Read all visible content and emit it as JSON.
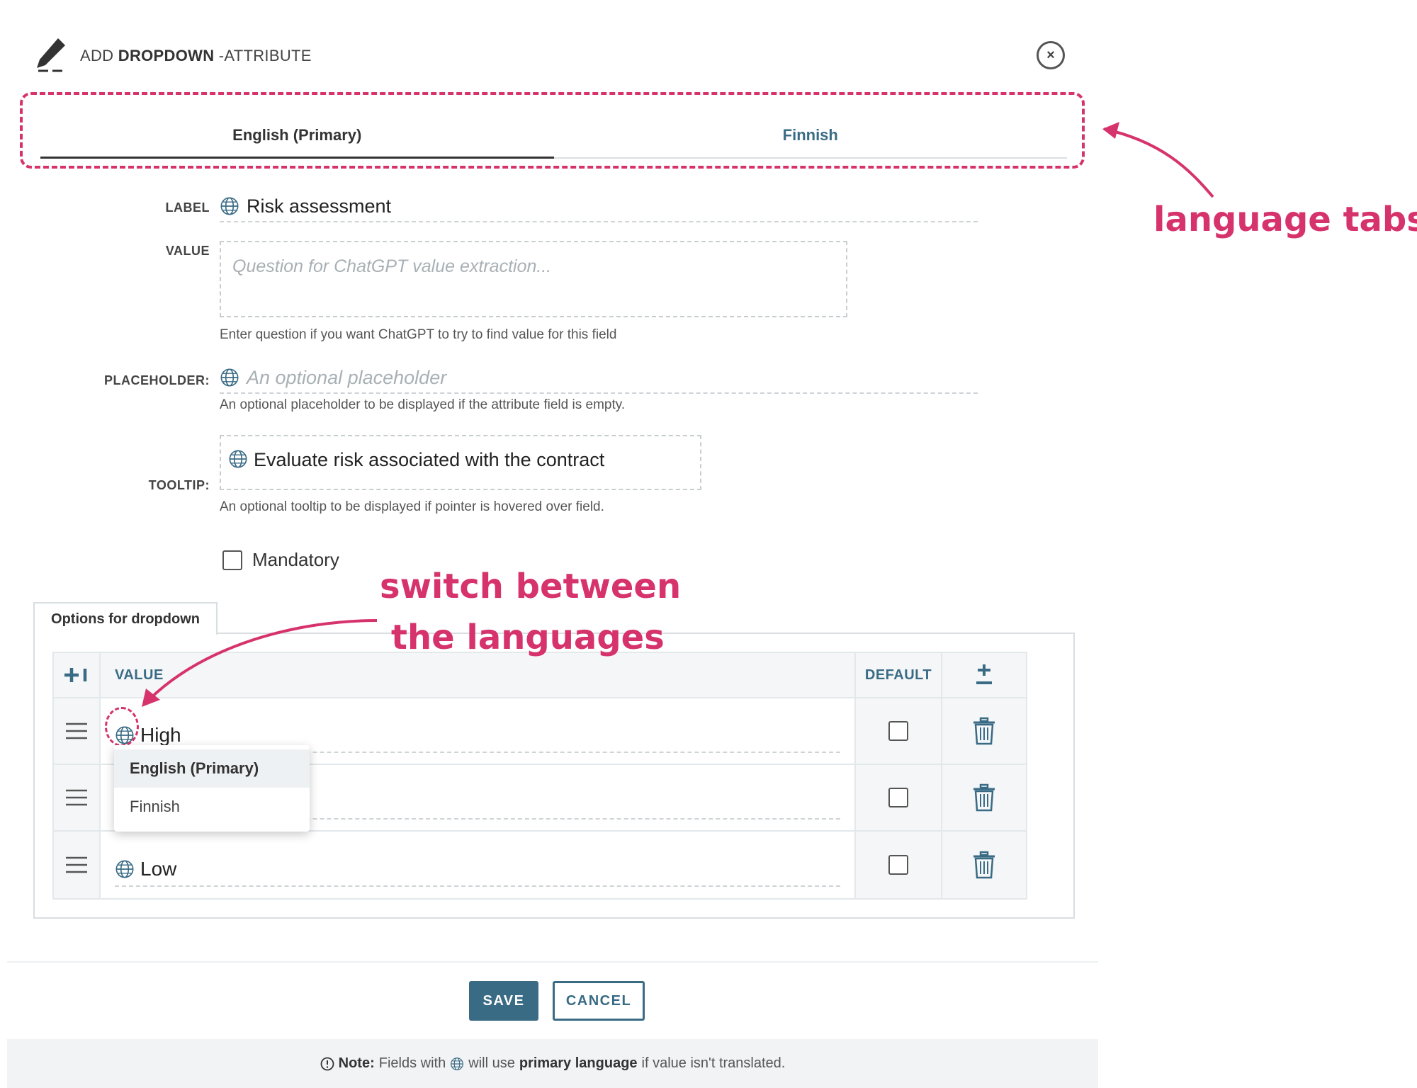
{
  "header": {
    "title_prefix": "ADD ",
    "title_bold": "DROPDOWN",
    "title_suffix": " -ATTRIBUTE",
    "close_symbol": "×"
  },
  "tabs": [
    {
      "label": "English (Primary)",
      "active": true
    },
    {
      "label": "Finnish",
      "active": false
    }
  ],
  "form": {
    "label": {
      "caption": "LABEL",
      "value": "Risk assessment"
    },
    "value": {
      "caption": "VALUE",
      "placeholder": "Question for ChatGPT value extraction...",
      "help": "Enter question if you want ChatGPT to try to find value for this field"
    },
    "placeholder": {
      "caption": "PLACEHOLDER:",
      "placeholder": "An optional placeholder",
      "help": "An optional placeholder to be displayed if the attribute field is empty."
    },
    "tooltip": {
      "caption": "TOOLTIP:",
      "value": "Evaluate risk associated with the contract",
      "help": "An optional tooltip to be displayed if pointer is hovered over field."
    },
    "mandatory": {
      "label": "Mandatory",
      "checked": false
    }
  },
  "options": {
    "tab_label": "Options for dropdown",
    "columns": {
      "value": "VALUE",
      "default": "DEFAULT"
    },
    "rows": [
      {
        "value": "High",
        "default": false
      },
      {
        "value": "",
        "default": false
      },
      {
        "value": "Low",
        "default": false
      }
    ]
  },
  "language_menu": {
    "items": [
      "English (Primary)",
      "Finnish"
    ],
    "selected": "English (Primary)"
  },
  "annotations": {
    "tabs": "language tabs",
    "switch_line1": "switch between",
    "switch_line2": "the languages"
  },
  "footer": {
    "save": "SAVE",
    "cancel": "CANCEL",
    "note_label": "Note:",
    "note_text_1": "Fields with",
    "note_text_2": "will use",
    "note_bold": "primary language",
    "note_text_3": "if value isn't translated."
  },
  "colors": {
    "accent": "#3a6b85",
    "annotation": "#d6336c"
  },
  "icons": [
    "pencil-icon",
    "close-icon",
    "globe-icon",
    "add-row-icon",
    "plus-minus-icon",
    "hamburger-icon",
    "trash-icon",
    "info-icon"
  ]
}
